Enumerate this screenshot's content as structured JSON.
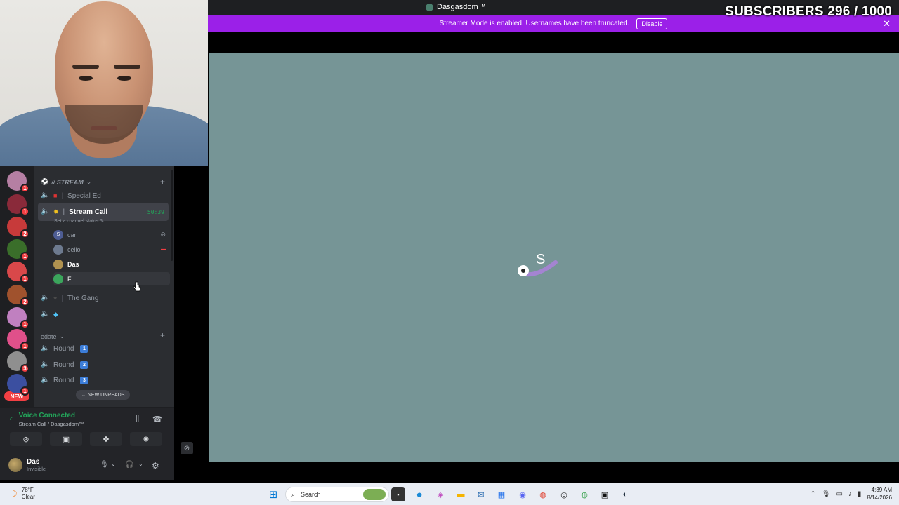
{
  "window": {
    "title": "Dasgasdom™",
    "subscriber_overlay": "SUBSCRIBERS 296 / 1000"
  },
  "banner": {
    "text": "Streamer Mode is enabled. Usernames have been truncated.",
    "button": "Disable",
    "close": "✕",
    "color": "#9b20e8"
  },
  "servers": [
    {
      "badge": "1",
      "color": "#b57fa3"
    },
    {
      "badge": "1",
      "color": "#8a2a3a"
    },
    {
      "badge": "2",
      "color": "#c73a3a"
    },
    {
      "badge": "1",
      "color": "#3a6e2a"
    },
    {
      "badge": "1",
      "color": "#d9484a"
    },
    {
      "badge": "2",
      "color": "#a0522d"
    },
    {
      "badge": "1",
      "color": "#c080c0"
    },
    {
      "badge": "1",
      "color": "#e0508a"
    },
    {
      "badge": "3",
      "color": "#8f8f8f"
    },
    {
      "badge": "1",
      "color": "#3b4fa0"
    }
  ],
  "new_label": "NEW",
  "channels": {
    "category_stream": "// STREAM",
    "special_ed": "Special Ed",
    "stream_call": "Stream Call",
    "stream_call_timer": "50:39",
    "set_status": "Set a channel status",
    "members": [
      {
        "name": "carl",
        "avatar_letter": "S",
        "avatar_color": "#5865f2"
      },
      {
        "name": "cello",
        "avatar_letter": "",
        "avatar_color": "#6d7a8f"
      },
      {
        "name": "Das",
        "avatar_letter": "",
        "avatar_color": "#b09250"
      },
      {
        "name": "F...",
        "avatar_letter": "",
        "avatar_color": "#3ba55c"
      }
    ],
    "the_gang": "The Gang",
    "category_edate": "edate",
    "rounds": [
      {
        "label": "Round",
        "num": "1"
      },
      {
        "label": "Round",
        "num": "2"
      },
      {
        "label": "Round",
        "num": "3"
      }
    ],
    "new_unreads": "NEW UNREADS"
  },
  "voice": {
    "status": "Voice Connected",
    "location": "Stream Call / Dasgasdom™"
  },
  "user": {
    "name": "Das",
    "status": "Invisible"
  },
  "stage": {
    "color": "#769596",
    "logo_letter": "S"
  },
  "taskbar": {
    "temp": "78°F",
    "condition": "Clear",
    "search_placeholder": "Search",
    "time": "4:39 AM",
    "date": "8/14/2026"
  }
}
